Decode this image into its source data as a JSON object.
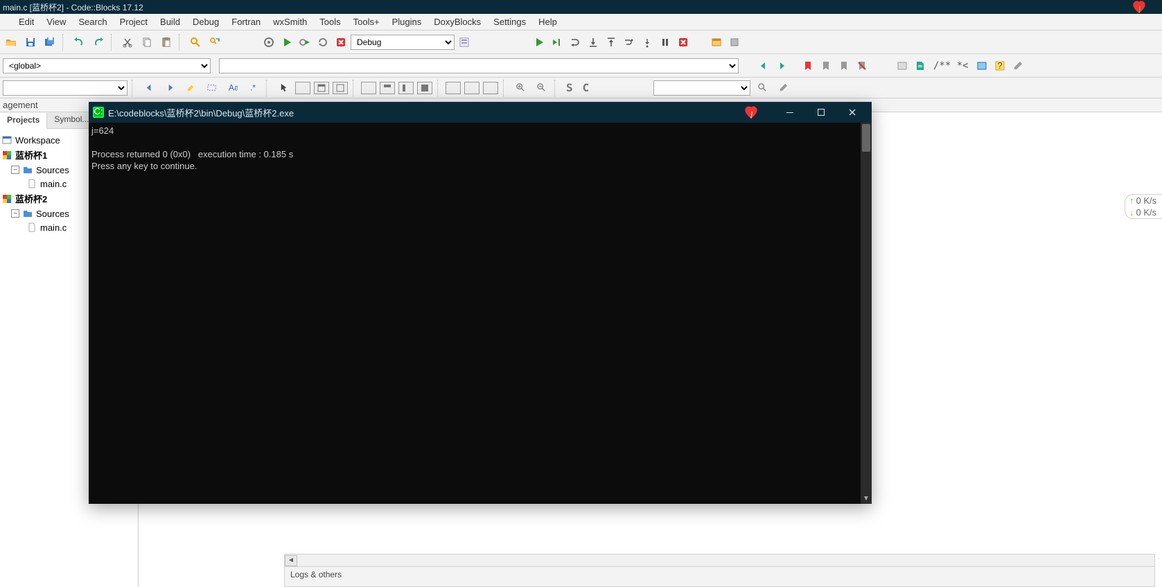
{
  "ide": {
    "title": "main.c [蓝桥杯2] - Code::Blocks 17.12"
  },
  "menu": {
    "items": [
      "Edit",
      "View",
      "Search",
      "Project",
      "Build",
      "Debug",
      "Fortran",
      "wxSmith",
      "Tools",
      "Tools+",
      "Plugins",
      "DoxyBlocks",
      "Settings",
      "Help"
    ]
  },
  "toolbar1": {
    "scope_combo": "<global>",
    "build_target": "Debug",
    "find_combo": ""
  },
  "mgmt": {
    "label": "agement"
  },
  "tabs": {
    "projects": "Projects",
    "symbols": "Symbol..."
  },
  "tree": {
    "workspace": "Workspace",
    "projects": [
      {
        "name": "蓝桥杯1",
        "sources_label": "Sources",
        "files": [
          "main.c"
        ]
      },
      {
        "name": "蓝桥杯2",
        "sources_label": "Sources",
        "files": [
          "main.c"
        ]
      }
    ]
  },
  "footer": {
    "logs_label": "Logs & others"
  },
  "console": {
    "title": "E:\\codeblocks\\蓝桥杯2\\bin\\Debug\\蓝桥杯2.exe",
    "lines": [
      "j=624",
      "",
      "Process returned 0 (0x0)   execution time : 0.185 s",
      "Press any key to continue."
    ]
  },
  "netspeed": {
    "up": "0  K/s",
    "dn": "0  K/s"
  },
  "toolbar_text": {
    "comment": "/** *<",
    "S": "S",
    "C": "C"
  }
}
